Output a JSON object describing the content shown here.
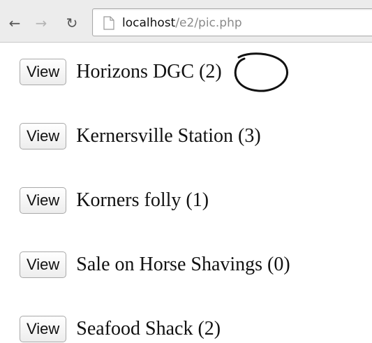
{
  "browser": {
    "url_host": "localhost",
    "url_path": "/e2/pic.php",
    "back_icon": "arrow-left-icon",
    "forward_icon": "arrow-right-icon",
    "reload_icon": "reload-icon",
    "page_icon": "page-icon"
  },
  "items": [
    {
      "button_label": "View",
      "name": "Horizons DGC (2)"
    },
    {
      "button_label": "View",
      "name": "Kernersville Station (3)"
    },
    {
      "button_label": "View",
      "name": "Korners folly (1)"
    },
    {
      "button_label": "View",
      "name": "Sale on Horse Shavings (0)"
    },
    {
      "button_label": "View",
      "name": "Seafood Shack (2)"
    }
  ]
}
